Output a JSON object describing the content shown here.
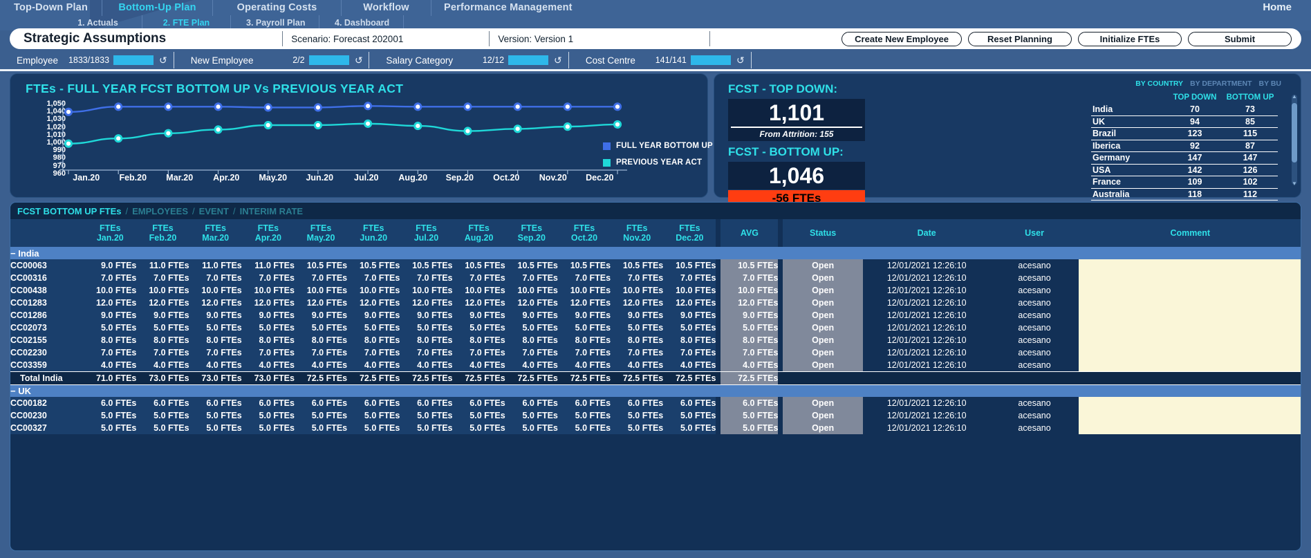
{
  "nav": {
    "primary": [
      {
        "label": "Top-Down Plan",
        "active": false
      },
      {
        "label": "Bottom-Up Plan",
        "active": true
      },
      {
        "label": "Operating Costs",
        "active": false
      },
      {
        "label": "Workflow",
        "active": false
      },
      {
        "label": "Performance Management",
        "active": false
      }
    ],
    "secondary": [
      {
        "label": "1. Actuals",
        "active": false
      },
      {
        "label": "2. FTE Plan",
        "active": true
      },
      {
        "label": "3. Payroll Plan",
        "active": false
      },
      {
        "label": "4. Dashboard",
        "active": false
      }
    ],
    "home": "Home"
  },
  "titlebar": {
    "title": "Strategic Assumptions",
    "scenario": "Scenario: Forecast 202001",
    "version": "Version: Version 1",
    "buttons": [
      "Create New Employee",
      "Reset Planning",
      "Initialize FTEs",
      "Submit"
    ]
  },
  "filters": [
    {
      "label": "Employee",
      "count": "1833/1833",
      "reset_icon": "reset-icon"
    },
    {
      "label": "New Employee",
      "count": "2/2",
      "reset_icon": "reset-icon"
    },
    {
      "label": "Salary Category",
      "count": "12/12",
      "reset_icon": "reset-icon"
    },
    {
      "label": "Cost Centre",
      "count": "141/141",
      "reset_icon": "reset-icon"
    }
  ],
  "chart_data": {
    "type": "line",
    "title": "FTEs - FULL YEAR FCST BOTTOM UP Vs PREVIOUS YEAR ACT",
    "xlabel": "",
    "ylabel": "",
    "ylim": [
      960,
      1050
    ],
    "yticks": [
      "1,050",
      "1,040",
      "1,030",
      "1,020",
      "1,010",
      "1,000",
      "990",
      "980",
      "970",
      "960"
    ],
    "grid": false,
    "legend_position": "right",
    "categories": [
      "Jan.20",
      "Feb.20",
      "Mar.20",
      "Apr.20",
      "May.20",
      "Jun.20",
      "Jul.20",
      "Aug.20",
      "Sep.20",
      "Oct.20",
      "Nov.20",
      "Dec.20"
    ],
    "series": [
      {
        "name": "FULL YEAR BOTTOM UP",
        "color": "#3f6fe8",
        "values": [
          1038,
          1045,
          1045,
          1045,
          1044,
          1044,
          1046,
          1045,
          1045,
          1045,
          1045,
          1045
        ]
      },
      {
        "name": "PREVIOUS YEAR ACT",
        "color": "#1fd8d8",
        "values": [
          995,
          1002,
          1009,
          1014,
          1020,
          1020,
          1022,
          1019,
          1012,
          1015,
          1018,
          1021
        ]
      }
    ]
  },
  "kpi": {
    "topdown_label": "FCST - TOP DOWN:",
    "topdown_value": "1,101",
    "topdown_sub": "From Attrition: 155",
    "bottomup_label": "FCST - BOTTOM UP:",
    "bottomup_value": "1,046",
    "delta_value": "-56 FTEs",
    "delta_color": "#ff3d11",
    "tabs": [
      {
        "label": "BY COUNTRY",
        "active": true
      },
      {
        "label": "BY DEPARTMENT",
        "active": false
      },
      {
        "label": "BY BU",
        "active": false
      }
    ],
    "country_table": {
      "headers": [
        "",
        "TOP DOWN",
        "BOTTOM UP"
      ],
      "rows": [
        {
          "country": "India",
          "topdown": "70",
          "bottomup": "73"
        },
        {
          "country": "UK",
          "topdown": "94",
          "bottomup": "85"
        },
        {
          "country": "Brazil",
          "topdown": "123",
          "bottomup": "115"
        },
        {
          "country": "Iberica",
          "topdown": "92",
          "bottomup": "87"
        },
        {
          "country": "Germany",
          "topdown": "147",
          "bottomup": "147"
        },
        {
          "country": "USA",
          "topdown": "142",
          "bottomup": "126"
        },
        {
          "country": "France",
          "topdown": "109",
          "bottomup": "102"
        },
        {
          "country": "Australia",
          "topdown": "118",
          "bottomup": "112"
        }
      ]
    }
  },
  "grid": {
    "tabs": [
      {
        "label": "FCST BOTTOM UP FTEs",
        "active": true
      },
      {
        "label": "EMPLOYEES",
        "active": false
      },
      {
        "label": "EVENT",
        "active": false
      },
      {
        "label": "INTERIM RATE",
        "active": false
      }
    ],
    "tab_separator": "/",
    "headers": {
      "code": "",
      "months": [
        "FTEs\nJan.20",
        "FTEs\nFeb.20",
        "FTEs\nMar.20",
        "FTEs\nApr.20",
        "FTEs\nMay.20",
        "FTEs\nJun.20",
        "FTEs\nJul.20",
        "FTEs\nAug.20",
        "FTEs\nSep.20",
        "FTEs\nOct.20",
        "FTEs\nNov.20",
        "FTEs\nDec.20"
      ],
      "avg": "AVG",
      "status": "Status",
      "date": "Date",
      "user": "User",
      "comment": "Comment"
    },
    "groups": [
      {
        "name": "India",
        "collapse_icon": "minus-icon",
        "rows": [
          {
            "code": "CC00063",
            "values": [
              "9.0 FTEs",
              "11.0 FTEs",
              "11.0 FTEs",
              "11.0 FTEs",
              "10.5 FTEs",
              "10.5 FTEs",
              "10.5 FTEs",
              "10.5 FTEs",
              "10.5 FTEs",
              "10.5 FTEs",
              "10.5 FTEs",
              "10.5 FTEs"
            ],
            "avg": "10.5 FTEs",
            "status": "Open",
            "date": "12/01/2021 12:26:10",
            "user": "acesano",
            "comment": ""
          },
          {
            "code": "CC00316",
            "values": [
              "7.0 FTEs",
              "7.0 FTEs",
              "7.0 FTEs",
              "7.0 FTEs",
              "7.0 FTEs",
              "7.0 FTEs",
              "7.0 FTEs",
              "7.0 FTEs",
              "7.0 FTEs",
              "7.0 FTEs",
              "7.0 FTEs",
              "7.0 FTEs"
            ],
            "avg": "7.0 FTEs",
            "status": "Open",
            "date": "12/01/2021 12:26:10",
            "user": "acesano",
            "comment": ""
          },
          {
            "code": "CC00438",
            "values": [
              "10.0 FTEs",
              "10.0 FTEs",
              "10.0 FTEs",
              "10.0 FTEs",
              "10.0 FTEs",
              "10.0 FTEs",
              "10.0 FTEs",
              "10.0 FTEs",
              "10.0 FTEs",
              "10.0 FTEs",
              "10.0 FTEs",
              "10.0 FTEs"
            ],
            "avg": "10.0 FTEs",
            "status": "Open",
            "date": "12/01/2021 12:26:10",
            "user": "acesano",
            "comment": ""
          },
          {
            "code": "CC01283",
            "values": [
              "12.0 FTEs",
              "12.0 FTEs",
              "12.0 FTEs",
              "12.0 FTEs",
              "12.0 FTEs",
              "12.0 FTEs",
              "12.0 FTEs",
              "12.0 FTEs",
              "12.0 FTEs",
              "12.0 FTEs",
              "12.0 FTEs",
              "12.0 FTEs"
            ],
            "avg": "12.0 FTEs",
            "status": "Open",
            "date": "12/01/2021 12:26:10",
            "user": "acesano",
            "comment": ""
          },
          {
            "code": "CC01286",
            "values": [
              "9.0 FTEs",
              "9.0 FTEs",
              "9.0 FTEs",
              "9.0 FTEs",
              "9.0 FTEs",
              "9.0 FTEs",
              "9.0 FTEs",
              "9.0 FTEs",
              "9.0 FTEs",
              "9.0 FTEs",
              "9.0 FTEs",
              "9.0 FTEs"
            ],
            "avg": "9.0 FTEs",
            "status": "Open",
            "date": "12/01/2021 12:26:10",
            "user": "acesano",
            "comment": ""
          },
          {
            "code": "CC02073",
            "values": [
              "5.0 FTEs",
              "5.0 FTEs",
              "5.0 FTEs",
              "5.0 FTEs",
              "5.0 FTEs",
              "5.0 FTEs",
              "5.0 FTEs",
              "5.0 FTEs",
              "5.0 FTEs",
              "5.0 FTEs",
              "5.0 FTEs",
              "5.0 FTEs"
            ],
            "avg": "5.0 FTEs",
            "status": "Open",
            "date": "12/01/2021 12:26:10",
            "user": "acesano",
            "comment": ""
          },
          {
            "code": "CC02155",
            "values": [
              "8.0 FTEs",
              "8.0 FTEs",
              "8.0 FTEs",
              "8.0 FTEs",
              "8.0 FTEs",
              "8.0 FTEs",
              "8.0 FTEs",
              "8.0 FTEs",
              "8.0 FTEs",
              "8.0 FTEs",
              "8.0 FTEs",
              "8.0 FTEs"
            ],
            "avg": "8.0 FTEs",
            "status": "Open",
            "date": "12/01/2021 12:26:10",
            "user": "acesano",
            "comment": ""
          },
          {
            "code": "CC02230",
            "values": [
              "7.0 FTEs",
              "7.0 FTEs",
              "7.0 FTEs",
              "7.0 FTEs",
              "7.0 FTEs",
              "7.0 FTEs",
              "7.0 FTEs",
              "7.0 FTEs",
              "7.0 FTEs",
              "7.0 FTEs",
              "7.0 FTEs",
              "7.0 FTEs"
            ],
            "avg": "7.0 FTEs",
            "status": "Open",
            "date": "12/01/2021 12:26:10",
            "user": "acesano",
            "comment": ""
          },
          {
            "code": "CC03359",
            "values": [
              "4.0 FTEs",
              "4.0 FTEs",
              "4.0 FTEs",
              "4.0 FTEs",
              "4.0 FTEs",
              "4.0 FTEs",
              "4.0 FTEs",
              "4.0 FTEs",
              "4.0 FTEs",
              "4.0 FTEs",
              "4.0 FTEs",
              "4.0 FTEs"
            ],
            "avg": "4.0 FTEs",
            "status": "Open",
            "date": "12/01/2021 12:26:10",
            "user": "acesano",
            "comment": ""
          }
        ],
        "total": {
          "label": "Total India",
          "values": [
            "71.0 FTEs",
            "73.0 FTEs",
            "73.0 FTEs",
            "73.0 FTEs",
            "72.5 FTEs",
            "72.5 FTEs",
            "72.5 FTEs",
            "72.5 FTEs",
            "72.5 FTEs",
            "72.5 FTEs",
            "72.5 FTEs",
            "72.5 FTEs"
          ],
          "avg": "72.5 FTEs"
        }
      },
      {
        "name": "UK",
        "collapse_icon": "minus-icon",
        "rows": [
          {
            "code": "CC00182",
            "values": [
              "6.0 FTEs",
              "6.0 FTEs",
              "6.0 FTEs",
              "6.0 FTEs",
              "6.0 FTEs",
              "6.0 FTEs",
              "6.0 FTEs",
              "6.0 FTEs",
              "6.0 FTEs",
              "6.0 FTEs",
              "6.0 FTEs",
              "6.0 FTEs"
            ],
            "avg": "6.0 FTEs",
            "status": "Open",
            "date": "12/01/2021 12:26:10",
            "user": "acesano",
            "comment": ""
          },
          {
            "code": "CC00230",
            "values": [
              "5.0 FTEs",
              "5.0 FTEs",
              "5.0 FTEs",
              "5.0 FTEs",
              "5.0 FTEs",
              "5.0 FTEs",
              "5.0 FTEs",
              "5.0 FTEs",
              "5.0 FTEs",
              "5.0 FTEs",
              "5.0 FTEs",
              "5.0 FTEs"
            ],
            "avg": "5.0 FTEs",
            "status": "Open",
            "date": "12/01/2021 12:26:10",
            "user": "acesano",
            "comment": ""
          },
          {
            "code": "CC00327",
            "values": [
              "5.0 FTEs",
              "5.0 FTEs",
              "5.0 FTEs",
              "5.0 FTEs",
              "5.0 FTEs",
              "5.0 FTEs",
              "5.0 FTEs",
              "5.0 FTEs",
              "5.0 FTEs",
              "5.0 FTEs",
              "5.0 FTEs",
              "5.0 FTEs"
            ],
            "avg": "5.0 FTEs",
            "status": "Open",
            "date": "12/01/2021 12:26:10",
            "user": "acesano",
            "comment": ""
          }
        ],
        "total": null
      }
    ]
  }
}
